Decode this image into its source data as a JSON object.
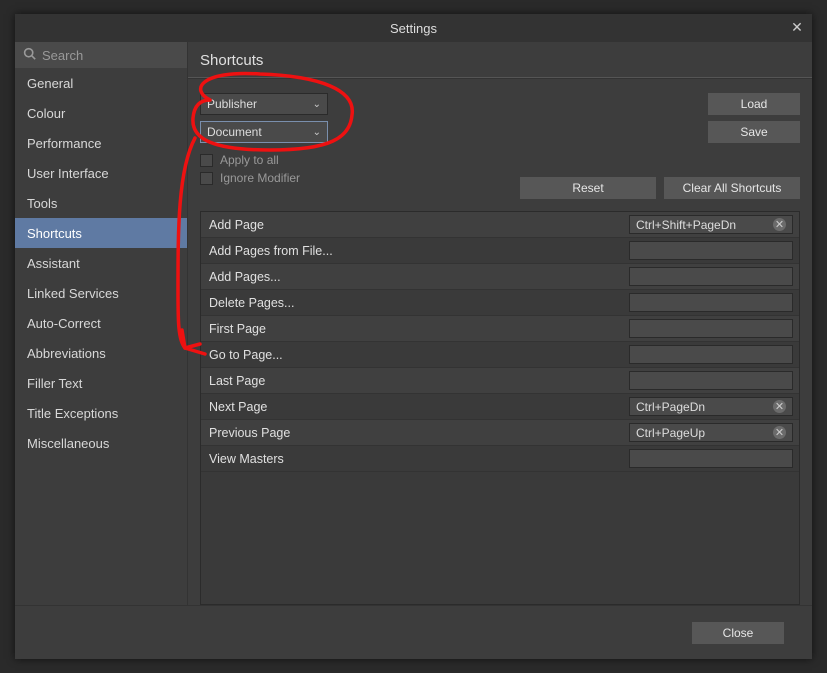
{
  "window": {
    "title": "Settings"
  },
  "search": {
    "placeholder": "Search"
  },
  "sidebar": {
    "items": [
      {
        "label": "General"
      },
      {
        "label": "Colour"
      },
      {
        "label": "Performance"
      },
      {
        "label": "User Interface"
      },
      {
        "label": "Tools"
      },
      {
        "label": "Shortcuts",
        "selected": true
      },
      {
        "label": "Assistant"
      },
      {
        "label": "Linked Services"
      },
      {
        "label": "Auto-Correct"
      },
      {
        "label": "Abbreviations"
      },
      {
        "label": "Filler Text"
      },
      {
        "label": "Title Exceptions"
      },
      {
        "label": "Miscellaneous"
      }
    ]
  },
  "panel": {
    "title": "Shortcuts",
    "profile_select": "Publisher",
    "group_select": "Document",
    "load_label": "Load",
    "save_label": "Save",
    "apply_all_label": "Apply to all",
    "ignore_modifier_label": "Ignore Modifier",
    "reset_label": "Reset",
    "clear_all_label": "Clear All Shortcuts"
  },
  "actions": [
    {
      "label": "Add Page",
      "shortcut": "Ctrl+Shift+PageDn"
    },
    {
      "label": "Add Pages from File...",
      "shortcut": ""
    },
    {
      "label": "Add Pages...",
      "shortcut": ""
    },
    {
      "label": "Delete Pages...",
      "shortcut": ""
    },
    {
      "label": "First Page",
      "shortcut": ""
    },
    {
      "label": "Go to Page...",
      "shortcut": ""
    },
    {
      "label": "Last Page",
      "shortcut": ""
    },
    {
      "label": "Next Page",
      "shortcut": "Ctrl+PageDn"
    },
    {
      "label": "Previous Page",
      "shortcut": "Ctrl+PageUp"
    },
    {
      "label": "View Masters",
      "shortcut": ""
    }
  ],
  "footer": {
    "close_label": "Close"
  }
}
